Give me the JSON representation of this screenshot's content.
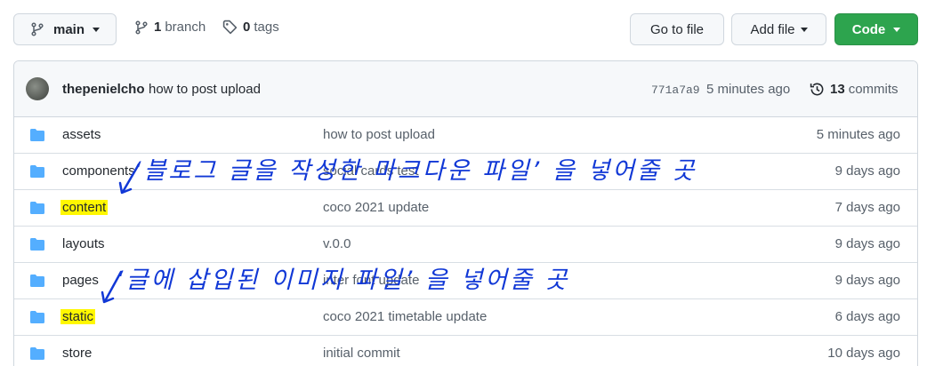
{
  "toolbar": {
    "branch_label": "main",
    "branches_count": "1",
    "branches_label": "branch",
    "tags_count": "0",
    "tags_label": "tags",
    "goto_file_label": "Go to file",
    "add_file_label": "Add file",
    "code_label": "Code"
  },
  "commit": {
    "author": "thepenielcho",
    "message": "how to post upload",
    "sha": "771a7a9",
    "time": "5 minutes ago",
    "count": "13",
    "count_label": "commits"
  },
  "files": [
    {
      "name": "assets",
      "message": "how to post upload",
      "age": "5 minutes ago",
      "highlight": false
    },
    {
      "name": "components",
      "message": "social cards test",
      "age": "9 days ago",
      "highlight": false
    },
    {
      "name": "content",
      "message": "coco 2021 update",
      "age": "7 days ago",
      "highlight": true
    },
    {
      "name": "layouts",
      "message": "v.0.0",
      "age": "9 days ago",
      "highlight": false
    },
    {
      "name": "pages",
      "message": "inter font update",
      "age": "9 days ago",
      "highlight": false
    },
    {
      "name": "static",
      "message": "coco 2021 timetable update",
      "age": "6 days ago",
      "highlight": true
    },
    {
      "name": "store",
      "message": "initial commit",
      "age": "10 days ago",
      "highlight": false
    }
  ],
  "annotations": {
    "content_note": "‘블로그 글을 작성한 마크다운 파일’ 을 넣어줄 곳",
    "static_note": "‘글에 삽입된 이미지 파일’ 을 넣어줄 곳"
  },
  "colors": {
    "primary_button": "#2da44e",
    "highlight": "#fff700",
    "annotation_ink": "#1138d6",
    "folder_icon": "#54aeff"
  },
  "icons": [
    "git-branch-icon",
    "tag-icon",
    "history-icon",
    "folder-icon"
  ]
}
